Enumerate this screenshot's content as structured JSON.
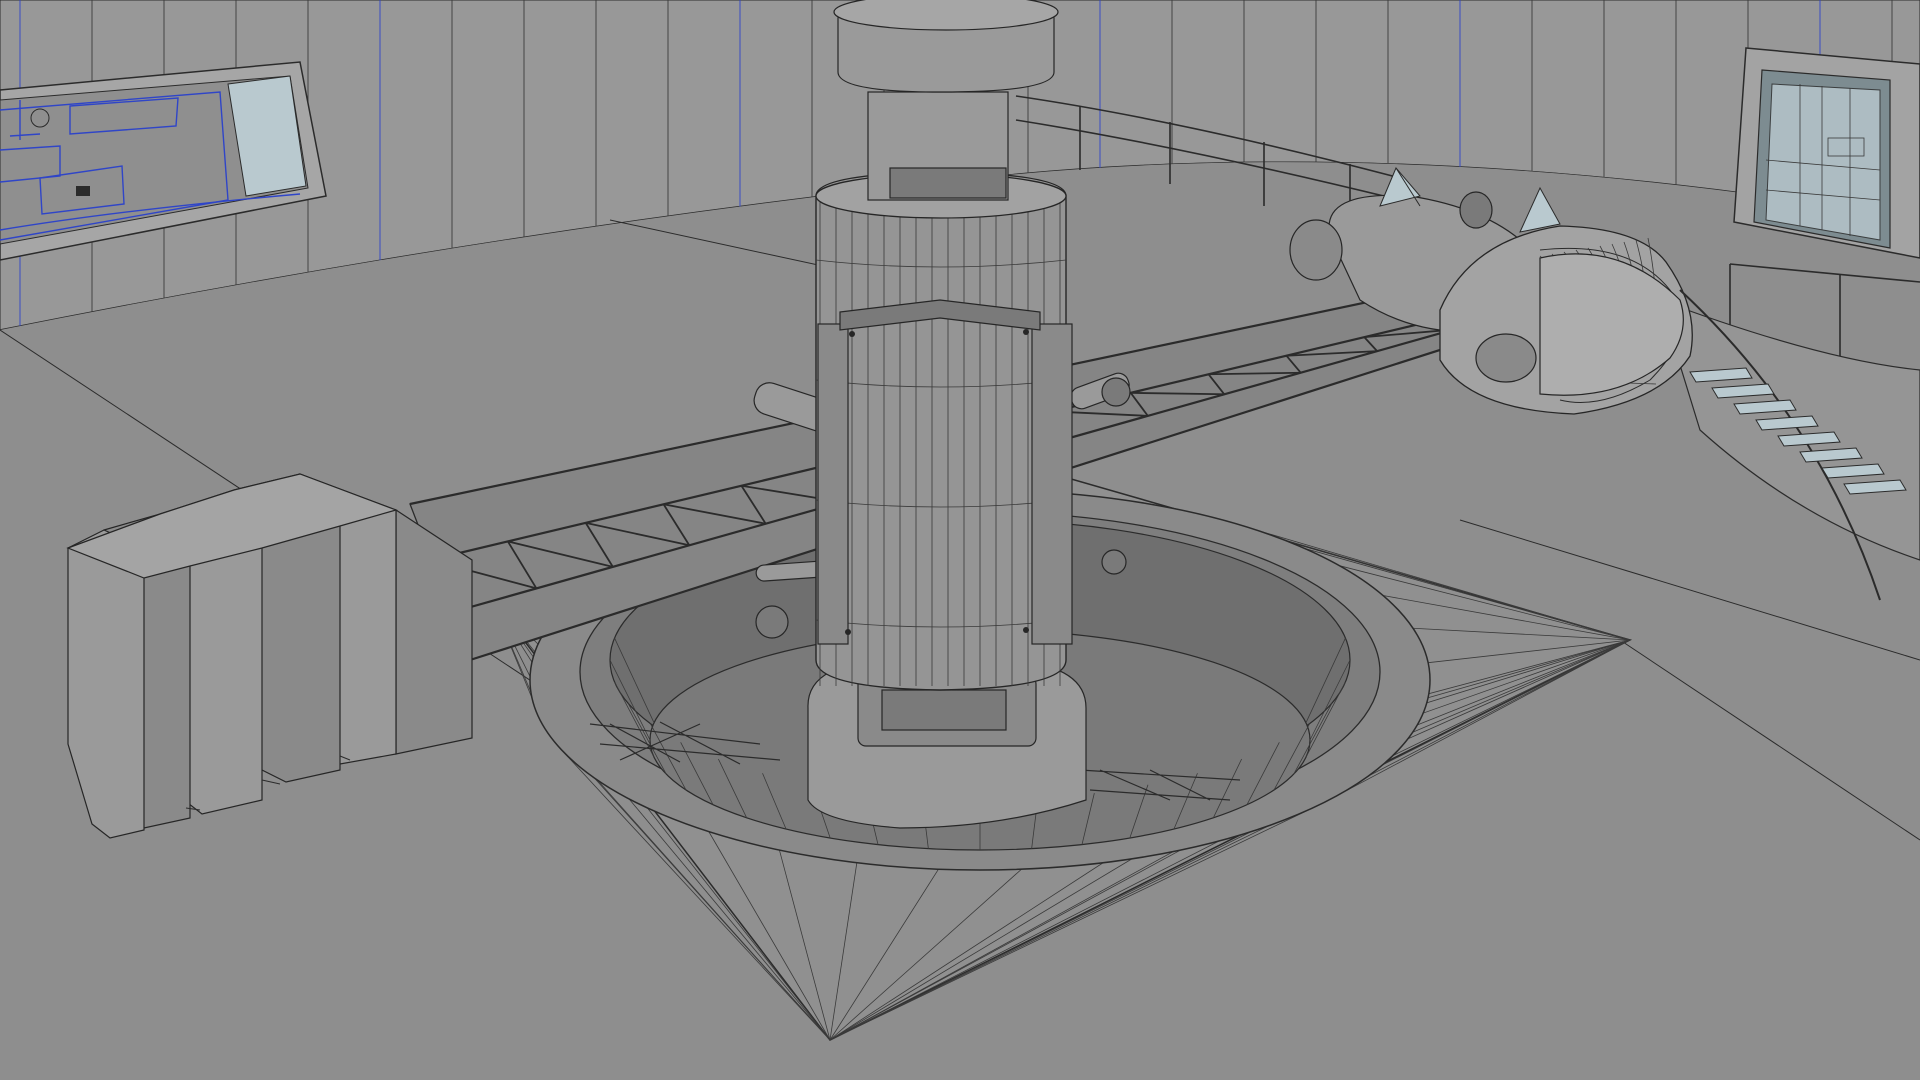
{
  "viewport": {
    "background_color": "#8f8f8f",
    "wire_color": "#2b2b2b",
    "selection_color": "#2f45c8",
    "glass_color": "#b9c9cf",
    "shading_mode_shown": "wireframe-on-shaded"
  },
  "scene_objects": [
    {
      "name": "central-column",
      "icon": "cylinder-mesh-icon"
    },
    {
      "name": "circular-pit",
      "icon": "ring-mesh-icon"
    },
    {
      "name": "lattice-truss-arm",
      "icon": "truss-icon"
    },
    {
      "name": "counterweight-block",
      "icon": "box-mesh-icon"
    },
    {
      "name": "capsule-pod",
      "icon": "capsule-icon"
    },
    {
      "name": "spiral-staircase",
      "icon": "stairs-icon"
    },
    {
      "name": "control-room-window",
      "icon": "window-icon"
    },
    {
      "name": "doorway",
      "icon": "door-icon"
    }
  ]
}
